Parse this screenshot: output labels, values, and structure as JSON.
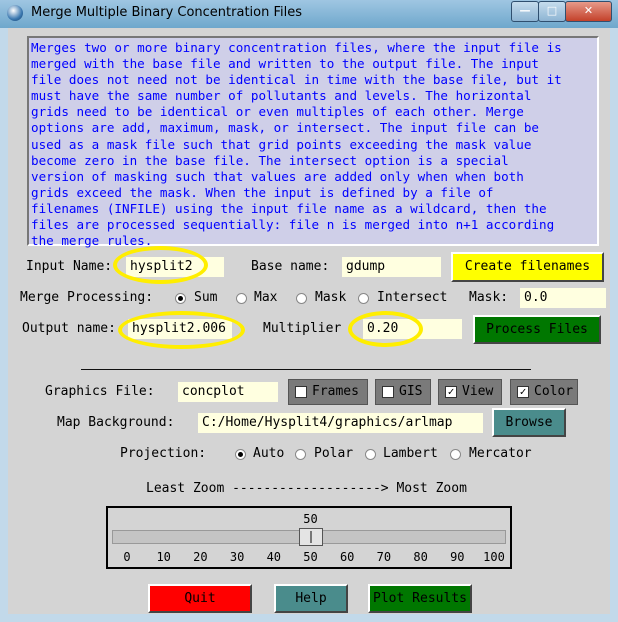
{
  "window": {
    "title": "Merge Multiple Binary Concentration Files",
    "controls": [
      "—",
      "□",
      "✕"
    ]
  },
  "description": "Merges two or more binary concentration files, where the input file is\nmerged with the base file and written to the output file. The input\nfile does not need not be identical in time with the base file, but it\nmust have the same number of pollutants and levels. The horizontal\ngrids need to be identical or even multiples of each other. Merge\noptions are add, maximum, mask, or intersect. The input file can be\nused as a mask file such that grid points exceeding the mask value\nbecome zero in the base file. The intersect option is a special\nversion of masking such that values are added only when when both\ngrids exceed the mask. When the input is defined by a file of\nfilenames (INFILE) using the input file name as a wildcard, then the\nfiles are processed sequentially: file n is merged into n+1 according\nthe merge rules.",
  "input": {
    "label": "Input Name:",
    "value": "hysplit2"
  },
  "base": {
    "label": "Base name:",
    "value": "gdump"
  },
  "create_filenames_label": "Create filenames",
  "merge": {
    "label": "Merge Processing:",
    "options": [
      "Sum",
      "Max",
      "Mask",
      "Intersect"
    ],
    "selected": "Sum",
    "mask_label": "Mask:",
    "mask_value": "0.0"
  },
  "output": {
    "label": "Output name:",
    "value": "hysplit2.006"
  },
  "multiplier": {
    "label": "Multiplier",
    "value": "0.20"
  },
  "process_files_label": "Process Files",
  "graphics": {
    "label": "Graphics File:",
    "value": "concplot",
    "checks": [
      {
        "label": "Frames",
        "checked": false
      },
      {
        "label": "GIS",
        "checked": false
      },
      {
        "label": "View",
        "checked": true
      },
      {
        "label": "Color",
        "checked": true
      }
    ]
  },
  "map": {
    "label": "Map Background:",
    "value": "C:/Home/Hysplit4/graphics/arlmap",
    "browse_label": "Browse"
  },
  "projection": {
    "label": "Projection:",
    "options": [
      "Auto",
      "Polar",
      "Lambert",
      "Mercator"
    ],
    "selected": "Auto"
  },
  "zoom": {
    "caption": "Least Zoom -------------------> Most Zoom",
    "value": 50,
    "min": 0,
    "max": 100,
    "ticks": [
      "0",
      "10",
      "20",
      "30",
      "40",
      "50",
      "60",
      "70",
      "80",
      "90",
      "100"
    ]
  },
  "buttons": {
    "quit": "Quit",
    "help": "Help",
    "plot": "Plot Results"
  },
  "colors": {
    "highlight": "#ffee00",
    "quit": "#ff0000",
    "help": "#4a8c8c",
    "process": "#007700",
    "create": "#ffff00"
  }
}
